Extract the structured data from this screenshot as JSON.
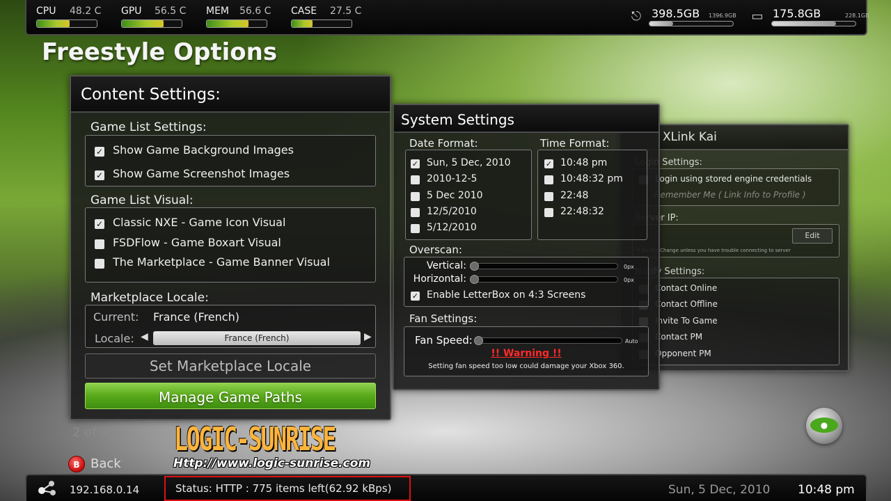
{
  "topbar": {
    "stats": [
      {
        "label": "CPU",
        "value": "48.2 C",
        "level": 0.55
      },
      {
        "label": "GPU",
        "value": "56.5 C",
        "level": 0.7
      },
      {
        "label": "MEM",
        "value": "56.6 C",
        "level": 0.7
      },
      {
        "label": "CASE",
        "value": "27.5 C",
        "level": 0.35
      }
    ],
    "drives": [
      {
        "icon": "usb-icon",
        "free": "398.5GB",
        "total": "1396.9GB",
        "level": 0.28
      },
      {
        "icon": "hdd-icon",
        "free": "175.8GB",
        "total": "228.1GB",
        "level": 0.77
      }
    ]
  },
  "page_title": "Freestyle Options",
  "content_settings": {
    "title": "Content Settings:",
    "game_list_settings": {
      "title": "Game List Settings:",
      "options": [
        {
          "label": "Show Game Background Images",
          "checked": true
        },
        {
          "label": "Show Game Screenshot Images",
          "checked": true
        }
      ]
    },
    "game_list_visual": {
      "title": "Game List Visual:",
      "options": [
        {
          "label": "Classic NXE - Game Icon Visual",
          "checked": true
        },
        {
          "label": "FSDFlow - Game Boxart Visual",
          "checked": false
        },
        {
          "label": "The Marketplace - Game Banner Visual",
          "checked": false
        }
      ]
    },
    "marketplace_locale": {
      "title": "Marketplace Locale:",
      "current_label": "Current:",
      "current_value": "France (French)",
      "locale_label": "Locale:",
      "locale_value": "France (French)"
    },
    "set_locale_button": "Set Marketplace Locale",
    "manage_paths_button": "Manage Game Paths"
  },
  "system_settings": {
    "title": "System Settings",
    "date_format": {
      "title": "Date Format:",
      "options": [
        {
          "label": "Sun, 5 Dec, 2010",
          "checked": true
        },
        {
          "label": "2010-12-5",
          "checked": false
        },
        {
          "label": "5 Dec 2010",
          "checked": false
        },
        {
          "label": "12/5/2010",
          "checked": false
        },
        {
          "label": "5/12/2010",
          "checked": false
        }
      ]
    },
    "time_format": {
      "title": "Time Format:",
      "options": [
        {
          "label": "10:48 pm",
          "checked": true
        },
        {
          "label": "10:48:32 pm",
          "checked": false
        },
        {
          "label": "22:48",
          "checked": false
        },
        {
          "label": "22:48:32",
          "checked": false
        }
      ]
    },
    "overscan": {
      "title": "Overscan:",
      "vertical_label": "Vertical:",
      "vertical_value": "0px",
      "horizontal_label": "Horizontal:",
      "horizontal_value": "0px",
      "letterbox_label": "Enable LetterBox on 4:3 Screens",
      "letterbox_checked": true
    },
    "fan": {
      "title": "Fan Settings:",
      "speed_label": "Fan Speed:",
      "speed_value": "Auto",
      "warning": "!! Warning !!",
      "warning_text": "Setting fan speed too low could damage your Xbox 360."
    }
  },
  "xlink": {
    "title_partial": "XLink Kai",
    "login_title": "Login Settings:",
    "login_stored": "Login using stored engine credentials",
    "remember_me": "Remember Me ( Link Info to Profile )",
    "server_title": "Server IP:",
    "edit_button": "Edit",
    "server_note": "* Do Not Change unless you have trouble connecting to server",
    "notify_title": "Notify Settings:",
    "notify_options": [
      "Contact Online",
      "Contact Offline",
      "Invite To Game",
      "Contact PM",
      "Opponent PM"
    ]
  },
  "page_indicator": "2 of 4",
  "back": {
    "button_letter": "B",
    "label": "Back"
  },
  "watermark": {
    "name": "LOGIC-SUNRISE",
    "url": "Http://www.logic-sunrise.com"
  },
  "bottombar": {
    "ip": "192.168.0.14",
    "status": "Status: HTTP : 775 items left(62.92 kBps)",
    "date": "Sun, 5 Dec, 2010",
    "time": "10:48 pm"
  },
  "colors": {
    "accent_green": "#58a819",
    "warning_red": "#ff2a2a",
    "highlight_red": "#e01010",
    "watermark_orange": "#ffb43c"
  }
}
